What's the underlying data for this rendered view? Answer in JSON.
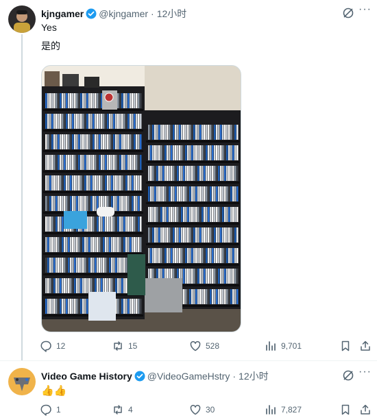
{
  "tweet1": {
    "display_name": "kjngamer",
    "handle": "@kjngamer",
    "time": "12小时",
    "line1": "Yes",
    "line2": "是的",
    "stats": {
      "replies": "12",
      "retweets": "15",
      "likes": "528",
      "views": "9,701"
    }
  },
  "tweet2": {
    "display_name": "Video Game History",
    "handle": "@VideoGameHstry",
    "time": "12小时",
    "text": "👍👍",
    "stats": {
      "replies": "1",
      "retweets": "4",
      "likes": "30",
      "views": "7,827"
    }
  },
  "colors": {
    "verified": "#1d9bf0",
    "muted": "#536471",
    "divider": "#eff3f4"
  },
  "icons": [
    "verified-badge-icon",
    "grok-icon",
    "more-icon",
    "reply-icon",
    "retweet-icon",
    "like-icon",
    "views-icon",
    "bookmark-icon",
    "share-icon"
  ]
}
